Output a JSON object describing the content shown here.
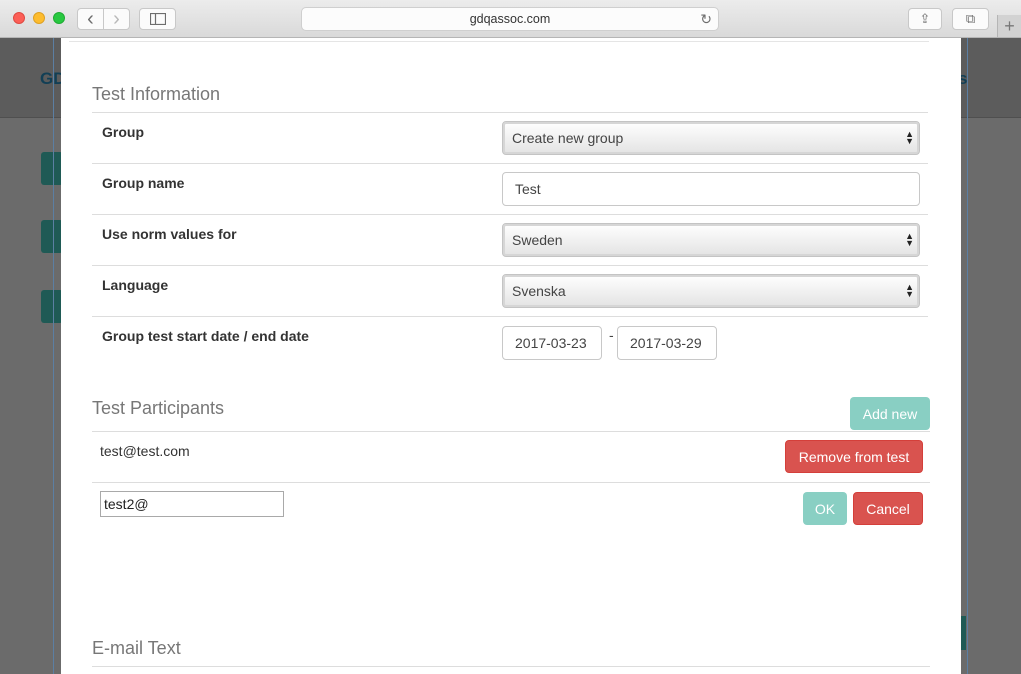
{
  "browser": {
    "url": "gdqassoc.com",
    "back_glyph": "‹",
    "forward_glyph": "›",
    "reload_glyph": "↻",
    "share_glyph": "⇪",
    "tabs_glyph": "⧉",
    "newtab_glyph": "+"
  },
  "background": {
    "logo_text": "GD",
    "right_text": "s"
  },
  "test_information": {
    "title": "Test Information",
    "rows": [
      {
        "label": "Group",
        "type": "select",
        "value": "Create new group"
      },
      {
        "label": "Group name",
        "type": "text",
        "value": "Test"
      },
      {
        "label": "Use norm values for",
        "type": "select",
        "value": "Sweden"
      },
      {
        "label": "Language",
        "type": "select",
        "value": "Svenska"
      },
      {
        "label": "Group test start date / end date",
        "type": "dates",
        "start": "2017-03-23",
        "separator": "-",
        "end": "2017-03-29"
      }
    ],
    "select_arrow_up": "▲",
    "select_arrow_down": "▼"
  },
  "test_participants": {
    "title": "Test Participants",
    "add_new_label": "Add new",
    "participants": [
      {
        "email": "test@test.com",
        "remove_label": "Remove from test"
      }
    ],
    "new_entry": {
      "value": "test2@",
      "ok_label": "OK",
      "cancel_label": "Cancel"
    }
  },
  "email_text": {
    "title": "E-mail Text"
  },
  "colors": {
    "teal_button": "#89cfc3",
    "red_button": "#d9534f",
    "section_title": "#777777"
  }
}
